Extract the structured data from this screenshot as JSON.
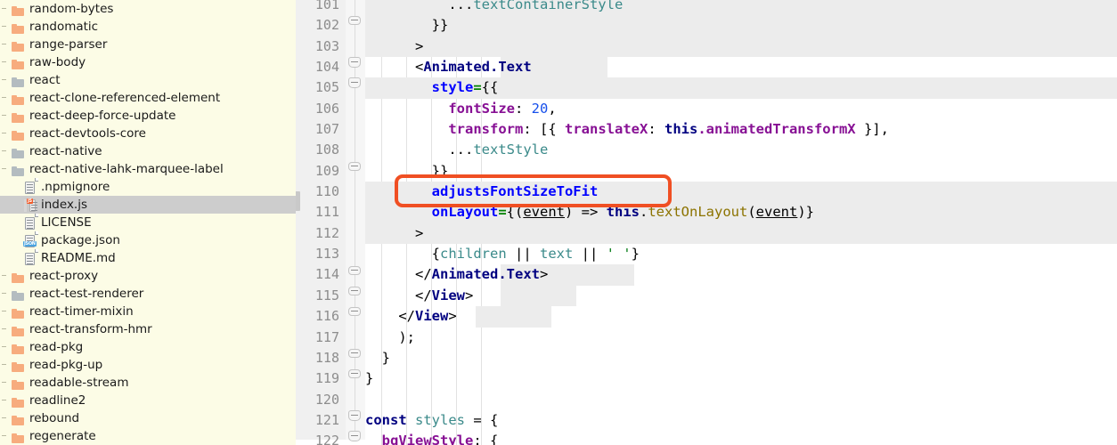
{
  "sidebar": {
    "background_color": "#fcfce6",
    "selected_color": "#cdcdcd",
    "folder_orange": "#f7ac7e",
    "folder_gray": "#b4bcc0",
    "items": [
      {
        "label": "random-bytes",
        "icon": "folder-orange-icon",
        "depth": 0,
        "selected": false
      },
      {
        "label": "randomatic",
        "icon": "folder-orange-icon",
        "depth": 0,
        "selected": false
      },
      {
        "label": "range-parser",
        "icon": "folder-orange-icon",
        "depth": 0,
        "selected": false
      },
      {
        "label": "raw-body",
        "icon": "folder-orange-icon",
        "depth": 0,
        "selected": false
      },
      {
        "label": "react",
        "icon": "folder-gray-icon",
        "depth": 0,
        "selected": false
      },
      {
        "label": "react-clone-referenced-element",
        "icon": "folder-orange-icon",
        "depth": 0,
        "selected": false
      },
      {
        "label": "react-deep-force-update",
        "icon": "folder-orange-icon",
        "depth": 0,
        "selected": false
      },
      {
        "label": "react-devtools-core",
        "icon": "folder-orange-icon",
        "depth": 0,
        "selected": false
      },
      {
        "label": "react-native",
        "icon": "folder-gray-icon",
        "depth": 0,
        "selected": false
      },
      {
        "label": "react-native-lahk-marquee-label",
        "icon": "folder-gray-icon",
        "depth": 0,
        "selected": false
      },
      {
        "label": ".npmignore",
        "icon": "file-doc-icon",
        "depth": 1,
        "selected": false
      },
      {
        "label": "index.js",
        "icon": "file-js-icon",
        "depth": 1,
        "selected": true
      },
      {
        "label": "LICENSE",
        "icon": "file-doc-icon",
        "depth": 1,
        "selected": false
      },
      {
        "label": "package.json",
        "icon": "file-json-icon",
        "depth": 1,
        "selected": false
      },
      {
        "label": "README.md",
        "icon": "file-doc-icon",
        "depth": 1,
        "selected": false
      },
      {
        "label": "react-proxy",
        "icon": "folder-orange-icon",
        "depth": 0,
        "selected": false
      },
      {
        "label": "react-test-renderer",
        "icon": "folder-gray-icon",
        "depth": 0,
        "selected": false
      },
      {
        "label": "react-timer-mixin",
        "icon": "folder-orange-icon",
        "depth": 0,
        "selected": false
      },
      {
        "label": "react-transform-hmr",
        "icon": "folder-orange-icon",
        "depth": 0,
        "selected": false
      },
      {
        "label": "read-pkg",
        "icon": "folder-orange-icon",
        "depth": 0,
        "selected": false
      },
      {
        "label": "read-pkg-up",
        "icon": "folder-orange-icon",
        "depth": 0,
        "selected": false
      },
      {
        "label": "readable-stream",
        "icon": "folder-orange-icon",
        "depth": 0,
        "selected": false
      },
      {
        "label": "readline2",
        "icon": "folder-orange-icon",
        "depth": 0,
        "selected": false
      },
      {
        "label": "rebound",
        "icon": "folder-orange-icon",
        "depth": 0,
        "selected": false
      },
      {
        "label": "regenerate",
        "icon": "folder-orange-icon",
        "depth": 0,
        "selected": false
      }
    ]
  },
  "editor": {
    "gutter_background": "#f0f0f0",
    "line_number_color": "#8d8d8d",
    "first_line_number": 101,
    "line_numbers": [
      101,
      102,
      103,
      104,
      105,
      106,
      107,
      108,
      109,
      110,
      111,
      112,
      113,
      114,
      115,
      116,
      117,
      118,
      119,
      120,
      121,
      122
    ],
    "fold_marker_lines": [
      102,
      104,
      105,
      109,
      114,
      115,
      116,
      118,
      119,
      121,
      122
    ],
    "highlighted_lines": [
      101,
      102,
      103,
      105,
      110,
      111,
      112
    ],
    "lines": [
      {
        "n": 101,
        "text": "          ...textContainerStyle"
      },
      {
        "n": 102,
        "text": "        }}"
      },
      {
        "n": 103,
        "text": "      >"
      },
      {
        "n": 104,
        "text": "      <Animated.Text"
      },
      {
        "n": 105,
        "text": "        style={{"
      },
      {
        "n": 106,
        "text": "          fontSize: 20,"
      },
      {
        "n": 107,
        "text": "          transform: [{ translateX: this.animatedTransformX }],"
      },
      {
        "n": 108,
        "text": "          ...textStyle"
      },
      {
        "n": 109,
        "text": "        }}"
      },
      {
        "n": 110,
        "text": "        adjustsFontSizeToFit"
      },
      {
        "n": 111,
        "text": "        onLayout={(event) => this.textOnLayout(event)}"
      },
      {
        "n": 112,
        "text": "      >"
      },
      {
        "n": 113,
        "text": "        {children || text || ' '}"
      },
      {
        "n": 114,
        "text": "      </Animated.Text>"
      },
      {
        "n": 115,
        "text": "      </View>"
      },
      {
        "n": 116,
        "text": "    </View>"
      },
      {
        "n": 117,
        "text": "    );"
      },
      {
        "n": 118,
        "text": "  }"
      },
      {
        "n": 119,
        "text": "}"
      },
      {
        "n": 120,
        "text": ""
      },
      {
        "n": 121,
        "text": "const styles = {"
      },
      {
        "n": 122,
        "text": "  bgViewStyle: {"
      }
    ]
  },
  "annotation": {
    "type": "highlight-rectangle",
    "color": "#f04f23",
    "targets_text": "adjustsFontSizeToFit"
  }
}
